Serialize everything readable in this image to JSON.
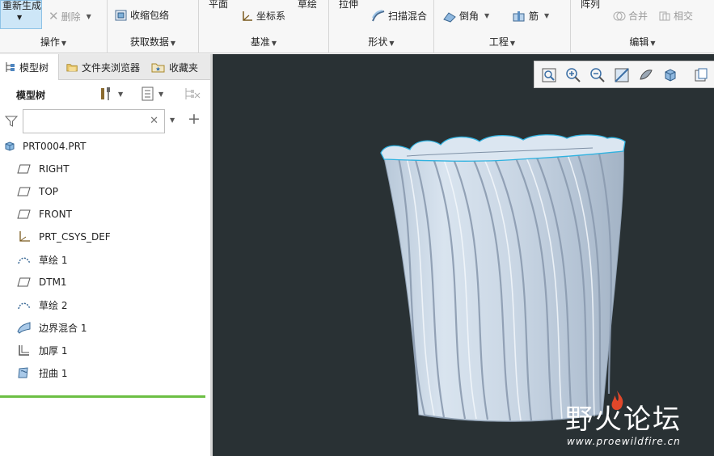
{
  "ribbon": {
    "regenerate_label": "重新生成",
    "delete_label": "删除",
    "shrinkwrap_label": "收缩包络",
    "plane_label": "平面",
    "sketch_label": "草绘",
    "csys_label": "坐标系",
    "extrude_label": "拉伸",
    "sweep_blend_label": "扫描混合",
    "round_label": "倒角",
    "rib_label": "筋",
    "pattern_label": "阵列",
    "merge_label": "合并",
    "intersect_label": "相交",
    "groups": {
      "operations": "操作",
      "get_data": "获取数据",
      "datum": "基准",
      "shapes": "形状",
      "engineering": "工程",
      "editing": "编辑"
    }
  },
  "left_panel": {
    "tabs": [
      {
        "label": "模型树"
      },
      {
        "label": "文件夹浏览器"
      },
      {
        "label": "收藏夹"
      }
    ],
    "tree_title": "模型树",
    "search_value": "",
    "search_placeholder": "",
    "tree": [
      {
        "label": "PRT0004.PRT",
        "icon": "part-icon"
      },
      {
        "label": "RIGHT",
        "icon": "datum-plane-icon"
      },
      {
        "label": "TOP",
        "icon": "datum-plane-icon"
      },
      {
        "label": "FRONT",
        "icon": "datum-plane-icon"
      },
      {
        "label": "PRT_CSYS_DEF",
        "icon": "csys-icon"
      },
      {
        "label": "草绘 1",
        "icon": "sketch-icon"
      },
      {
        "label": "DTM1",
        "icon": "datum-plane-icon"
      },
      {
        "label": "草绘 2",
        "icon": "sketch-icon"
      },
      {
        "label": "边界混合 1",
        "icon": "boundary-blend-icon"
      },
      {
        "label": "加厚 1",
        "icon": "thicken-icon"
      },
      {
        "label": "扭曲 1",
        "icon": "warp-icon"
      }
    ]
  },
  "view": {
    "watermark_cn": "野火论坛",
    "watermark_url": "www.proewildfire.cn"
  },
  "colors": {
    "background": "#293134",
    "model_fill": "#c9d5e3",
    "model_edge": "#2fb2e0",
    "tree_accent": "#6cbf44",
    "selection": "#cde6f7"
  }
}
